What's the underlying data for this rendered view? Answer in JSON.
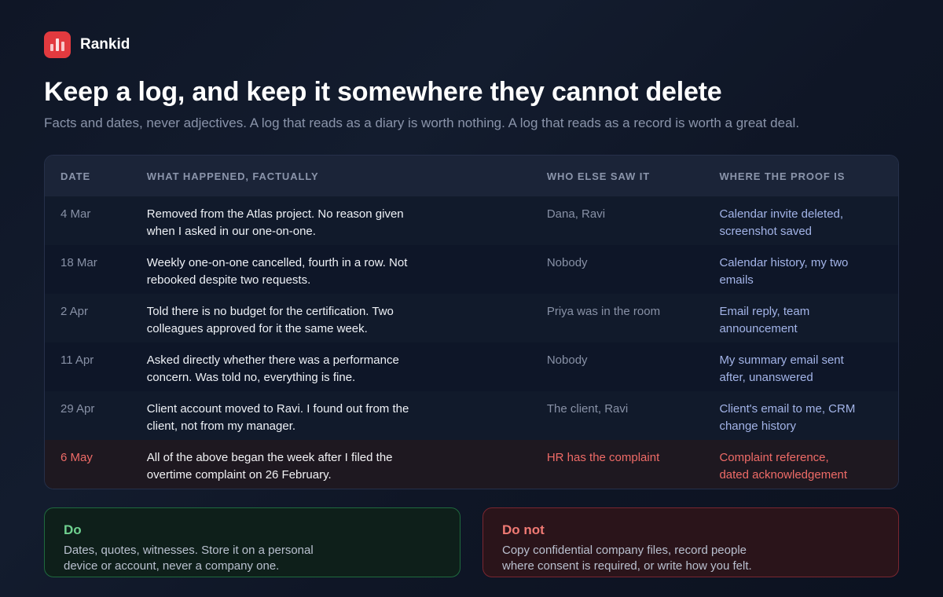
{
  "brand": {
    "name": "Rankid",
    "logo_icon": "bar-chart-icon",
    "accent": "#e23a3f"
  },
  "header": {
    "title": "Keep a log, and keep it somewhere they cannot delete",
    "subtitle": "Facts and dates, never adjectives. A log that reads as a diary is worth nothing. A log that reads as a record is worth a great deal."
  },
  "table": {
    "columns": [
      "DATE",
      "WHAT HAPPENED, FACTUALLY",
      "WHO ELSE SAW IT",
      "WHERE THE PROOF IS"
    ],
    "rows": [
      {
        "date": "4 Mar",
        "what": "Removed from the Atlas project. No reason given when I asked in our one-on-one.",
        "who": "Dana, Ravi",
        "proof": "Calendar invite deleted, screenshot saved"
      },
      {
        "date": "18 Mar",
        "what": "Weekly one-on-one cancelled, fourth in a row. Not rebooked despite two requests.",
        "who": "Nobody",
        "proof": "Calendar history, my two emails"
      },
      {
        "date": "2 Apr",
        "what": "Told there is no budget for the certification. Two colleagues approved for it the same week.",
        "who": "Priya was in the room",
        "proof": "Email reply, team announcement"
      },
      {
        "date": "11 Apr",
        "what": "Asked directly whether there was a performance concern. Was told no, everything is fine.",
        "who": "Nobody",
        "proof": "My summary email sent after, unanswered"
      },
      {
        "date": "29 Apr",
        "what": "Client account moved to Ravi. I found out from the client, not from my manager.",
        "who": "The client, Ravi",
        "proof": "Client's email to me, CRM change history"
      },
      {
        "date": "6 May",
        "what": "All of the above began the week after I filed the overtime complaint on 26 February.",
        "who": "HR has the complaint",
        "proof": "Complaint reference, dated acknowledgement"
      }
    ],
    "highlight_color": "#ef6b67"
  },
  "cards": {
    "do": {
      "title": "Do",
      "body": "Dates, quotes, witnesses. Store it on a personal device or account, never a company one.",
      "color": "#6fd08f"
    },
    "dont": {
      "title": "Do not",
      "body": "Copy confidential company files, record people where consent is required, or write how you felt.",
      "color": "#f07a74"
    }
  }
}
